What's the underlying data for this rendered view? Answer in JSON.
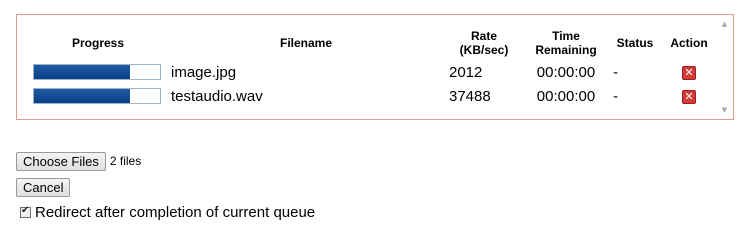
{
  "queue": {
    "headers": {
      "progress": "Progress",
      "filename": "Filename",
      "rate_line1": "Rate",
      "rate_line2": "(KB/sec)",
      "time_line1": "Time",
      "time_line2": "Remaining",
      "status": "Status",
      "action": "Action"
    },
    "rows": [
      {
        "progress": 0.76,
        "filename": "image.jpg",
        "rate": "2012",
        "time_remaining": "00:00:00",
        "status": "-",
        "action_icon": "delete-icon"
      },
      {
        "progress": 0.76,
        "filename": "testaudio.wav",
        "rate": "37488",
        "time_remaining": "00:00:00",
        "status": "-",
        "action_icon": "delete-icon"
      }
    ]
  },
  "file_input": {
    "button_label": "Choose Files",
    "status": "2 files"
  },
  "cancel_label": "Cancel",
  "redirect": {
    "checked": true,
    "label": "Redirect after completion of current queue"
  },
  "colors": {
    "panel_border": "#e0a085",
    "progress_fill": "#0b3f85",
    "delete_icon": "#d43a3a"
  }
}
